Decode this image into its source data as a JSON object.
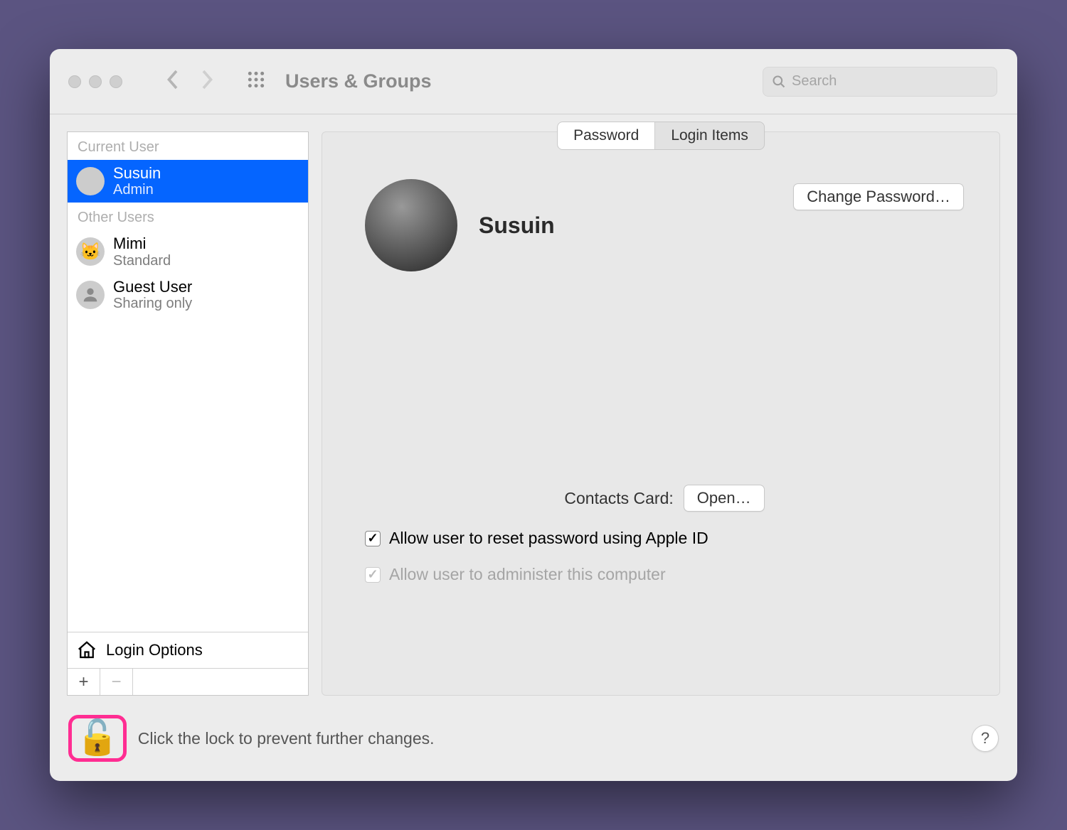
{
  "window": {
    "title": "Users & Groups"
  },
  "search": {
    "placeholder": "Search"
  },
  "sidebar": {
    "current_user_label": "Current User",
    "other_users_label": "Other Users",
    "users": [
      {
        "name": "Susuin",
        "role": "Admin"
      },
      {
        "name": "Mimi",
        "role": "Standard"
      },
      {
        "name": "Guest User",
        "role": "Sharing only"
      }
    ],
    "login_options_label": "Login Options"
  },
  "main": {
    "tabs": {
      "password": "Password",
      "login_items": "Login Items"
    },
    "profile_name": "Susuin",
    "change_password_label": "Change Password…",
    "contacts_card_label": "Contacts Card:",
    "open_button_label": "Open…",
    "allow_reset_label": "Allow user to reset password using Apple ID",
    "allow_admin_label": "Allow user to administer this computer"
  },
  "footer": {
    "lock_text": "Click the lock to prevent further changes.",
    "help_label": "?"
  }
}
